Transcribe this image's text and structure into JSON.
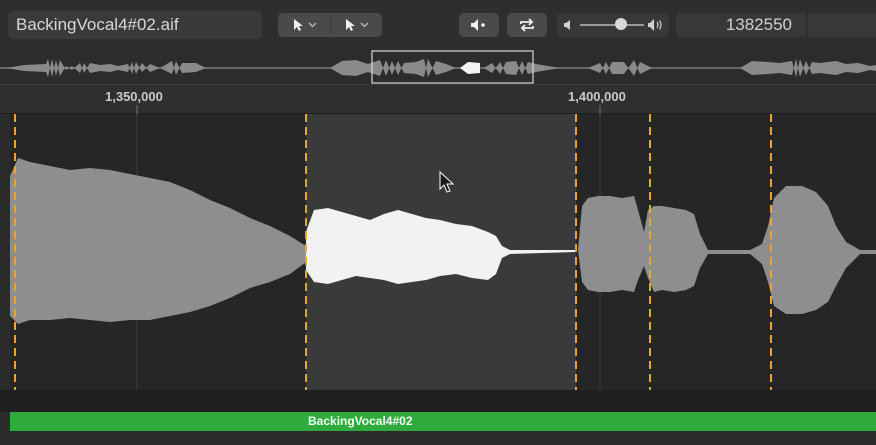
{
  "toolbar": {
    "filename": "BackingVocal4#02.aif",
    "left_click_tool_icon": "pointer-icon",
    "right_click_tool_icon": "pointer-icon",
    "position_value": "1382550"
  },
  "ruler": {
    "label_1": "1,350,000",
    "label_2": "1,400,000"
  },
  "region": {
    "name": "BackingVocal4#02"
  },
  "colors": {
    "marker": "#e8a33a",
    "region_green": "#2faa3d",
    "waveform": "#9a9a9a",
    "waveform_selected": "#f0f0f0"
  }
}
